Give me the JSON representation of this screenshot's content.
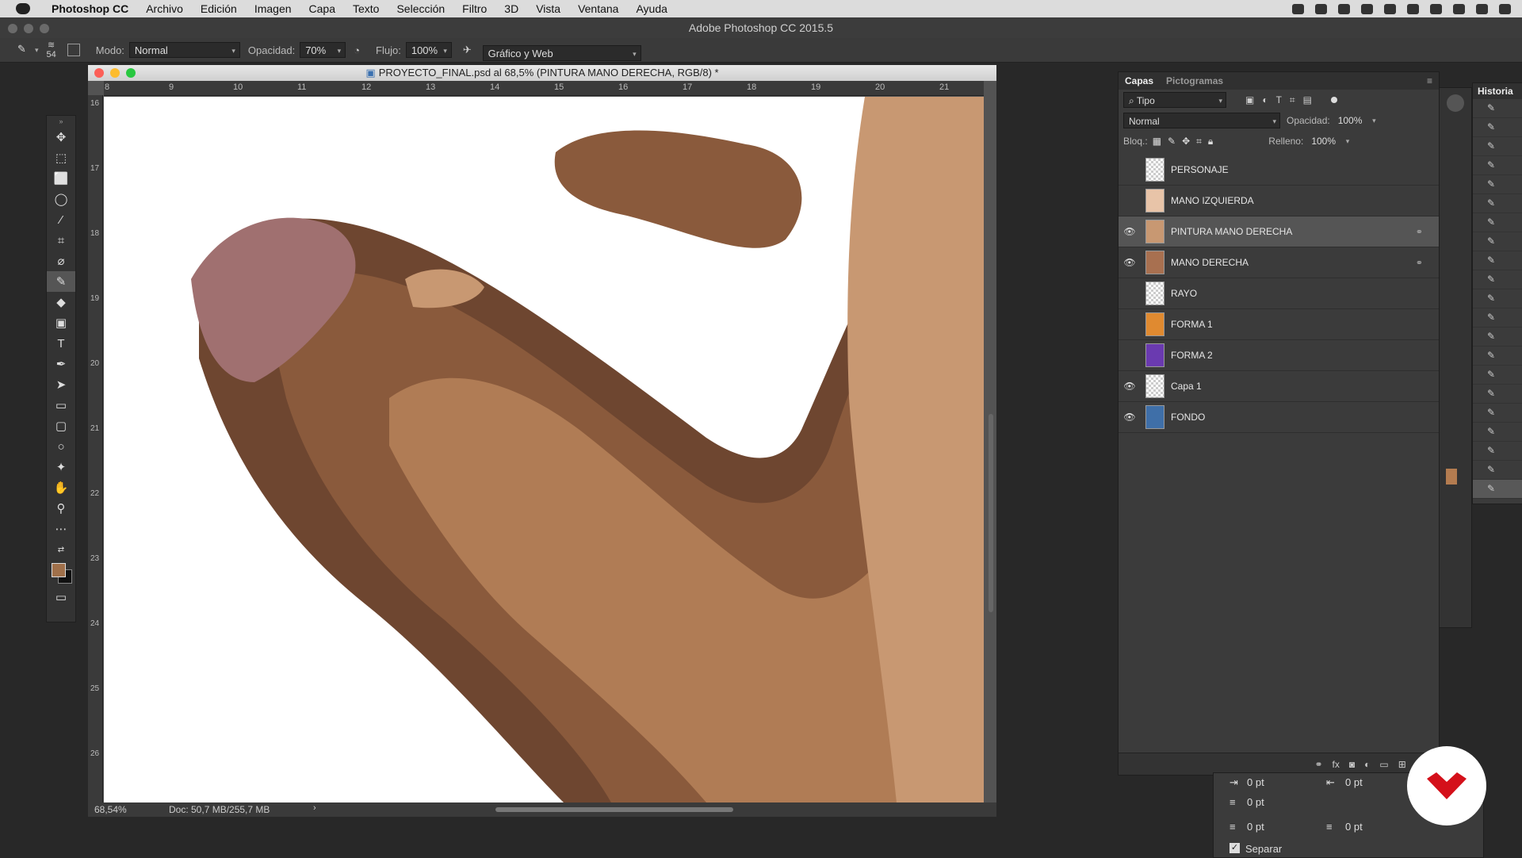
{
  "menubar": {
    "app": "Photoshop CC",
    "items": [
      "Archivo",
      "Edición",
      "Imagen",
      "Capa",
      "Texto",
      "Selección",
      "Filtro",
      "3D",
      "Vista",
      "Ventana",
      "Ayuda"
    ]
  },
  "window": {
    "title": "Adobe Photoshop CC 2015.5"
  },
  "options": {
    "brush_size": "54",
    "mode_label": "Modo:",
    "mode_value": "Normal",
    "opacity_label": "Opacidad:",
    "opacity_value": "70%",
    "flow_label": "Flujo:",
    "flow_value": "100%",
    "workspace": "Gráfico y Web"
  },
  "document": {
    "title": "PROYECTO_FINAL.psd al 68,5% (PINTURA MANO DERECHA, RGB/8) *",
    "ruler_h": [
      "8",
      "9",
      "10",
      "11",
      "12",
      "13",
      "14",
      "15",
      "16",
      "17",
      "18",
      "19",
      "20",
      "21"
    ],
    "ruler_v": [
      "16",
      "17",
      "18",
      "19",
      "20",
      "21",
      "22",
      "23",
      "24",
      "25",
      "26"
    ],
    "zoom": "68,54%",
    "doc_size": "Doc: 50,7 MB/255,7 MB",
    "colors": {
      "skin_light": "#c89872",
      "skin_mid": "#b07c55",
      "skin_dark": "#8a5a3c",
      "shadow": "#6e4630",
      "nail": "#a07070"
    }
  },
  "layers_panel": {
    "tabs": [
      "Capas",
      "Pictogramas"
    ],
    "filter": "Tipo",
    "blend_mode": "Normal",
    "opacity_label": "Opacidad:",
    "opacity_value": "100%",
    "lock_label": "Bloq.:",
    "fill_label": "Relleno:",
    "fill_value": "100%",
    "layers": [
      {
        "name": "PERSONAJE",
        "visible": false,
        "linked": false,
        "active": false,
        "thumb": "#e0e0e0"
      },
      {
        "name": "MANO IZQUIERDA",
        "visible": false,
        "linked": false,
        "active": false,
        "thumb": "#e8c4a8"
      },
      {
        "name": "PINTURA MANO DERECHA",
        "visible": true,
        "linked": true,
        "active": true,
        "thumb": "#c89872"
      },
      {
        "name": "MANO DERECHA",
        "visible": true,
        "linked": true,
        "active": false,
        "thumb": "#a87050"
      },
      {
        "name": "RAYO",
        "visible": false,
        "linked": false,
        "active": false,
        "thumb": "#ffffff"
      },
      {
        "name": "FORMA 1",
        "visible": false,
        "linked": false,
        "active": false,
        "thumb": "#e08a30"
      },
      {
        "name": "FORMA 2",
        "visible": false,
        "linked": false,
        "active": false,
        "thumb": "#6a3ab0"
      },
      {
        "name": "Capa 1",
        "visible": true,
        "linked": false,
        "active": false,
        "thumb": "#ffffff"
      },
      {
        "name": "FONDO",
        "visible": true,
        "linked": false,
        "active": false,
        "thumb": "#3f6fa8"
      }
    ]
  },
  "history": {
    "title": "Historia",
    "row_count": 21
  },
  "paragraph": {
    "values": [
      "0 pt",
      "0 pt",
      "0 pt",
      "0 pt",
      "0 pt"
    ],
    "hyphenate_label": "Separar",
    "hyphenate_checked": true
  },
  "brand": {
    "logo_color": "#d4101a"
  }
}
